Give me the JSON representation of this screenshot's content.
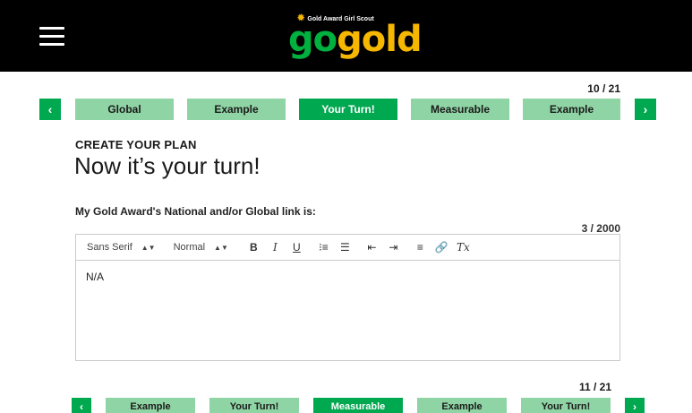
{
  "header": {
    "menu_icon": "hamburger-menu-icon",
    "logo": {
      "subtitle": "Gold Award Girl Scout",
      "go": "go",
      "gold": "gold"
    }
  },
  "top_nav": {
    "counter": "10 / 21",
    "prev_symbol": "‹",
    "next_symbol": "›",
    "steps": [
      {
        "label": "Global",
        "active": false
      },
      {
        "label": "Example",
        "active": false
      },
      {
        "label": "Your Turn!",
        "active": true
      },
      {
        "label": "Measurable",
        "active": false
      },
      {
        "label": "Example",
        "active": false
      }
    ]
  },
  "section": {
    "label": "CREATE YOUR PLAN",
    "title": "Now it’s your turn!"
  },
  "question": {
    "text": "My Gold Award's National and/or Global link is:",
    "char_count": "3 / 2000"
  },
  "editor": {
    "font_select": "Sans Serif",
    "size_select": "Normal",
    "bold": "B",
    "italic": "I",
    "underline": "U",
    "ordered_list": "⁝≡",
    "bullet_list": "☰",
    "outdent": "⇤",
    "indent": "⇥",
    "align": "≡",
    "link": "🔗",
    "clear": "Tx",
    "value": "N/A"
  },
  "bottom_nav": {
    "counter": "11 / 21",
    "prev_symbol": "‹",
    "next_symbol": "›",
    "steps": [
      {
        "label": "Example",
        "active": false
      },
      {
        "label": "Your Turn!",
        "active": false
      },
      {
        "label": "Measurable",
        "active": true
      },
      {
        "label": "Example",
        "active": false
      },
      {
        "label": "Your Turn!",
        "active": false
      }
    ]
  },
  "colors": {
    "header_bg": "#000000",
    "accent_green": "#00a84f",
    "light_green": "#8fd4a4",
    "gold": "#f5b700"
  }
}
